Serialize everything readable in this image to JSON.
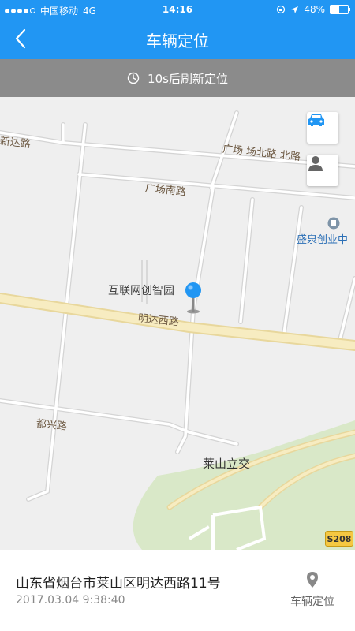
{
  "status": {
    "carrier": "中国移动",
    "network": "4G",
    "time": "14:16",
    "battery": "48%",
    "battery_level": 0.48
  },
  "header": {
    "title": "车辆定位",
    "back_icon": "chevron-left-icon"
  },
  "refresh": {
    "icon": "clock-icon",
    "text": "10s后刷新定位"
  },
  "map": {
    "labels": {
      "xinda_road": "新达路",
      "guangchang_north": "广场 场北路 北路",
      "guangchang_south": "广场南路",
      "shengquan": "盛泉创业中",
      "hulianwang": "互联网创智园",
      "mingda_west": "明达西路",
      "duxing_road": "都兴路",
      "laishan_interchange": "莱山立交",
      "route_s208": "S208"
    },
    "buttons": {
      "car": "car-icon",
      "person": "person-icon"
    }
  },
  "location": {
    "address": "山东省烟台市莱山区明达西路11号",
    "datetime": "2017.03.04   9:38:40",
    "button_label": "车辆定位",
    "button_icon": "map-pin-icon"
  },
  "colors": {
    "primary": "#2196f3",
    "refresh_bar": "#8b8b8b",
    "map_background": "#efefef",
    "pin": "#2196f3"
  }
}
